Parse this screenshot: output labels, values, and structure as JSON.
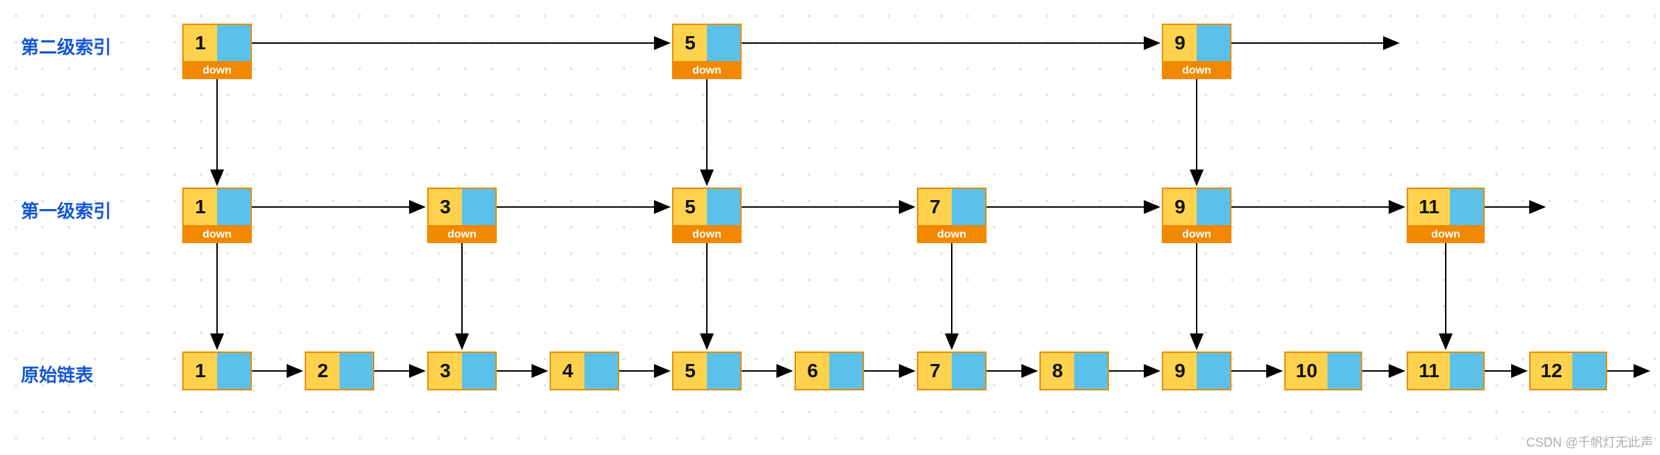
{
  "labels": {
    "level2": "第二级索引",
    "level1": "第一级索引",
    "level0": "原始链表",
    "down": "down",
    "watermark": "CSDN @千帆灯无此声"
  },
  "chart_data": {
    "type": "diagram",
    "description": "Skip list with two index levels over a base linked list",
    "levels": [
      {
        "name": "第二级索引",
        "nodes": [
          1,
          5,
          9
        ]
      },
      {
        "name": "第一级索引",
        "nodes": [
          1,
          3,
          5,
          7,
          9,
          11
        ]
      },
      {
        "name": "原始链表",
        "nodes": [
          1,
          2,
          3,
          4,
          5,
          6,
          7,
          8,
          9,
          10,
          11,
          12
        ]
      }
    ],
    "edges": {
      "horizontal": "each node points right to the next node in same level",
      "down": "each index node has a down pointer to the same-value node one level below"
    }
  },
  "layout": {
    "rowY": {
      "l2": 34,
      "l1": 270,
      "l0": 506
    },
    "colX": [
      262,
      438,
      614,
      790,
      966,
      1142,
      1318,
      1494,
      1670,
      1846,
      2022,
      2198
    ],
    "labelX": 30,
    "nodeW": 100,
    "nodeH": 56,
    "downH": 24
  },
  "level2": {
    "n0": "1",
    "n1": "5",
    "n2": "9"
  },
  "level1": {
    "n0": "1",
    "n1": "3",
    "n2": "5",
    "n3": "7",
    "n4": "9",
    "n5": "11"
  },
  "level0": {
    "n0": "1",
    "n1": "2",
    "n2": "3",
    "n3": "4",
    "n4": "5",
    "n5": "6",
    "n6": "7",
    "n7": "8",
    "n8": "9",
    "n9": "10",
    "n10": "11",
    "n11": "12"
  }
}
